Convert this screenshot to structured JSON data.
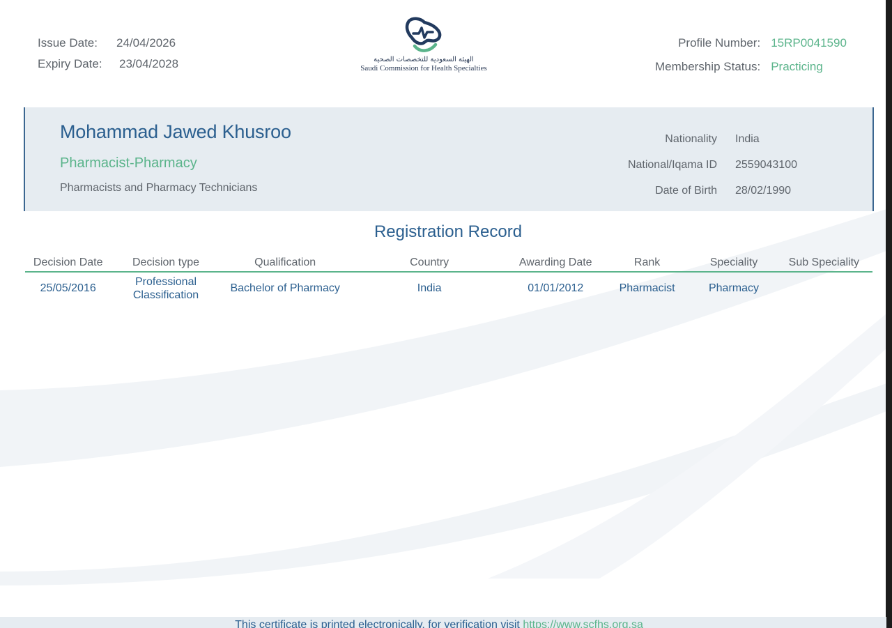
{
  "header": {
    "issue_label": "Issue Date:",
    "issue_value": "24/04/2026",
    "expiry_label": "Expiry Date:",
    "expiry_value": "23/04/2028",
    "logo_arabic": "الهيئة السعودية للتخصصات الصحية",
    "logo_english": "Saudi Commission for Health Specialties",
    "profile_label": "Profile Number:",
    "profile_value": "15RP0041590",
    "membership_label": "Membership Status:",
    "membership_value": "Practicing"
  },
  "profile": {
    "name": "Mohammad Jawed Khusroo",
    "profession": "Pharmacist-Pharmacy",
    "category": "Pharmacists and Pharmacy Technicians",
    "nationality_label": "Nationality",
    "nationality_value": "India",
    "id_label": "National/Iqama ID",
    "id_value": "2559043100",
    "dob_label": "Date of Birth",
    "dob_value": "28/02/1990"
  },
  "registration": {
    "title": "Registration Record",
    "columns": [
      "Decision Date",
      "Decision type",
      "Qualification",
      "Country",
      "Awarding Date",
      "Rank",
      "Speciality",
      "Sub Speciality"
    ],
    "rows": [
      {
        "decision_date": "25/05/2016",
        "decision_type_1": "Professional",
        "decision_type_2": "Classification",
        "qualification": "Bachelor of Pharmacy",
        "country": "India",
        "awarding_date": "01/01/2012",
        "rank": "Pharmacist",
        "speciality": "Pharmacy",
        "sub_speciality": ""
      }
    ]
  },
  "footer": {
    "text": "This certificate is printed electronically, for verification visit ",
    "link": "https://www.scfhs.org.sa"
  },
  "colors": {
    "primary_blue": "#2b5f8f",
    "accent_green": "#5bb48b",
    "band_bg": "#e6ecf1"
  }
}
